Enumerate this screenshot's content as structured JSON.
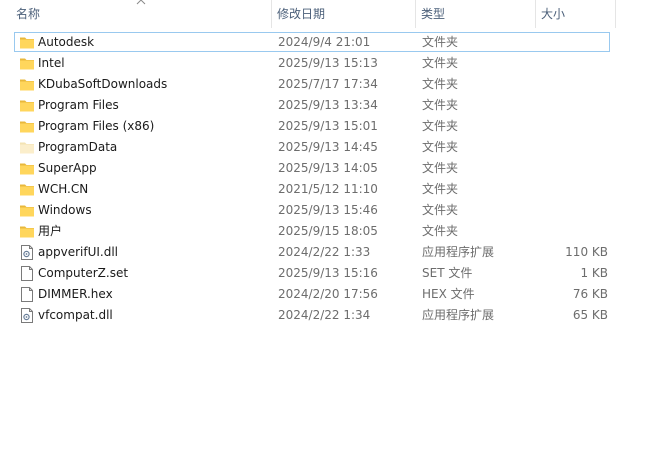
{
  "columns": {
    "name": "名称",
    "date": "修改日期",
    "type": "类型",
    "size": "大小"
  },
  "files": [
    {
      "name": "Autodesk",
      "date": "2024/9/4 21:01",
      "type": "文件夹",
      "size": "",
      "icon": "folder-icon",
      "focused": true
    },
    {
      "name": "Intel",
      "date": "2025/9/13 15:13",
      "type": "文件夹",
      "size": "",
      "icon": "folder-icon"
    },
    {
      "name": "KDubaSoftDownloads",
      "date": "2025/7/17 17:34",
      "type": "文件夹",
      "size": "",
      "icon": "folder-icon"
    },
    {
      "name": "Program Files",
      "date": "2025/9/13 13:34",
      "type": "文件夹",
      "size": "",
      "icon": "folder-icon"
    },
    {
      "name": "Program Files (x86)",
      "date": "2025/9/13 15:01",
      "type": "文件夹",
      "size": "",
      "icon": "folder-icon"
    },
    {
      "name": "ProgramData",
      "date": "2025/9/13 14:45",
      "type": "文件夹",
      "size": "",
      "icon": "hidden-folder-icon"
    },
    {
      "name": "SuperApp",
      "date": "2025/9/13 14:05",
      "type": "文件夹",
      "size": "",
      "icon": "folder-icon"
    },
    {
      "name": "WCH.CN",
      "date": "2021/5/12 11:10",
      "type": "文件夹",
      "size": "",
      "icon": "folder-icon"
    },
    {
      "name": "Windows",
      "date": "2025/9/13 15:46",
      "type": "文件夹",
      "size": "",
      "icon": "folder-icon"
    },
    {
      "name": "用户",
      "date": "2025/9/15 18:05",
      "type": "文件夹",
      "size": "",
      "icon": "folder-icon"
    },
    {
      "name": "appverifUI.dll",
      "date": "2024/2/22 1:33",
      "type": "应用程序扩展",
      "size": "110 KB",
      "icon": "dll-file-icon"
    },
    {
      "name": "ComputerZ.set",
      "date": "2025/9/13 15:16",
      "type": "SET 文件",
      "size": "1 KB",
      "icon": "file-icon"
    },
    {
      "name": "DIMMER.hex",
      "date": "2024/2/20 17:56",
      "type": "HEX 文件",
      "size": "76 KB",
      "icon": "file-icon"
    },
    {
      "name": "vfcompat.dll",
      "date": "2024/2/22 1:34",
      "type": "应用程序扩展",
      "size": "65 KB",
      "icon": "dll-file-icon"
    }
  ],
  "colors": {
    "folder": "#ffd65c",
    "folder_dark": "#e8b83c",
    "focus_border": "#99c9ef",
    "header_text": "#4c607a"
  },
  "sort_indicator": "chevron-up-icon"
}
